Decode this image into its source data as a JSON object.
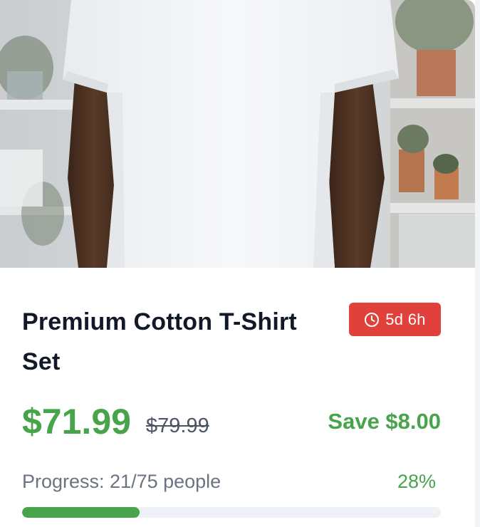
{
  "product": {
    "title": "Premium Cotton T-Shirt Set",
    "image_alt": "Man wearing white cotton t-shirt"
  },
  "timer": {
    "icon": "clock-icon",
    "label": "5d 6h",
    "color": "#e0413a"
  },
  "pricing": {
    "current": "$71.99",
    "original": "$79.99",
    "savings": "Save $8.00",
    "accent_color": "#47a44b"
  },
  "progress": {
    "label": "Progress: 21/75 people",
    "joined": 21,
    "goal": 75,
    "percent_label": "28%",
    "fraction": 0.28
  }
}
